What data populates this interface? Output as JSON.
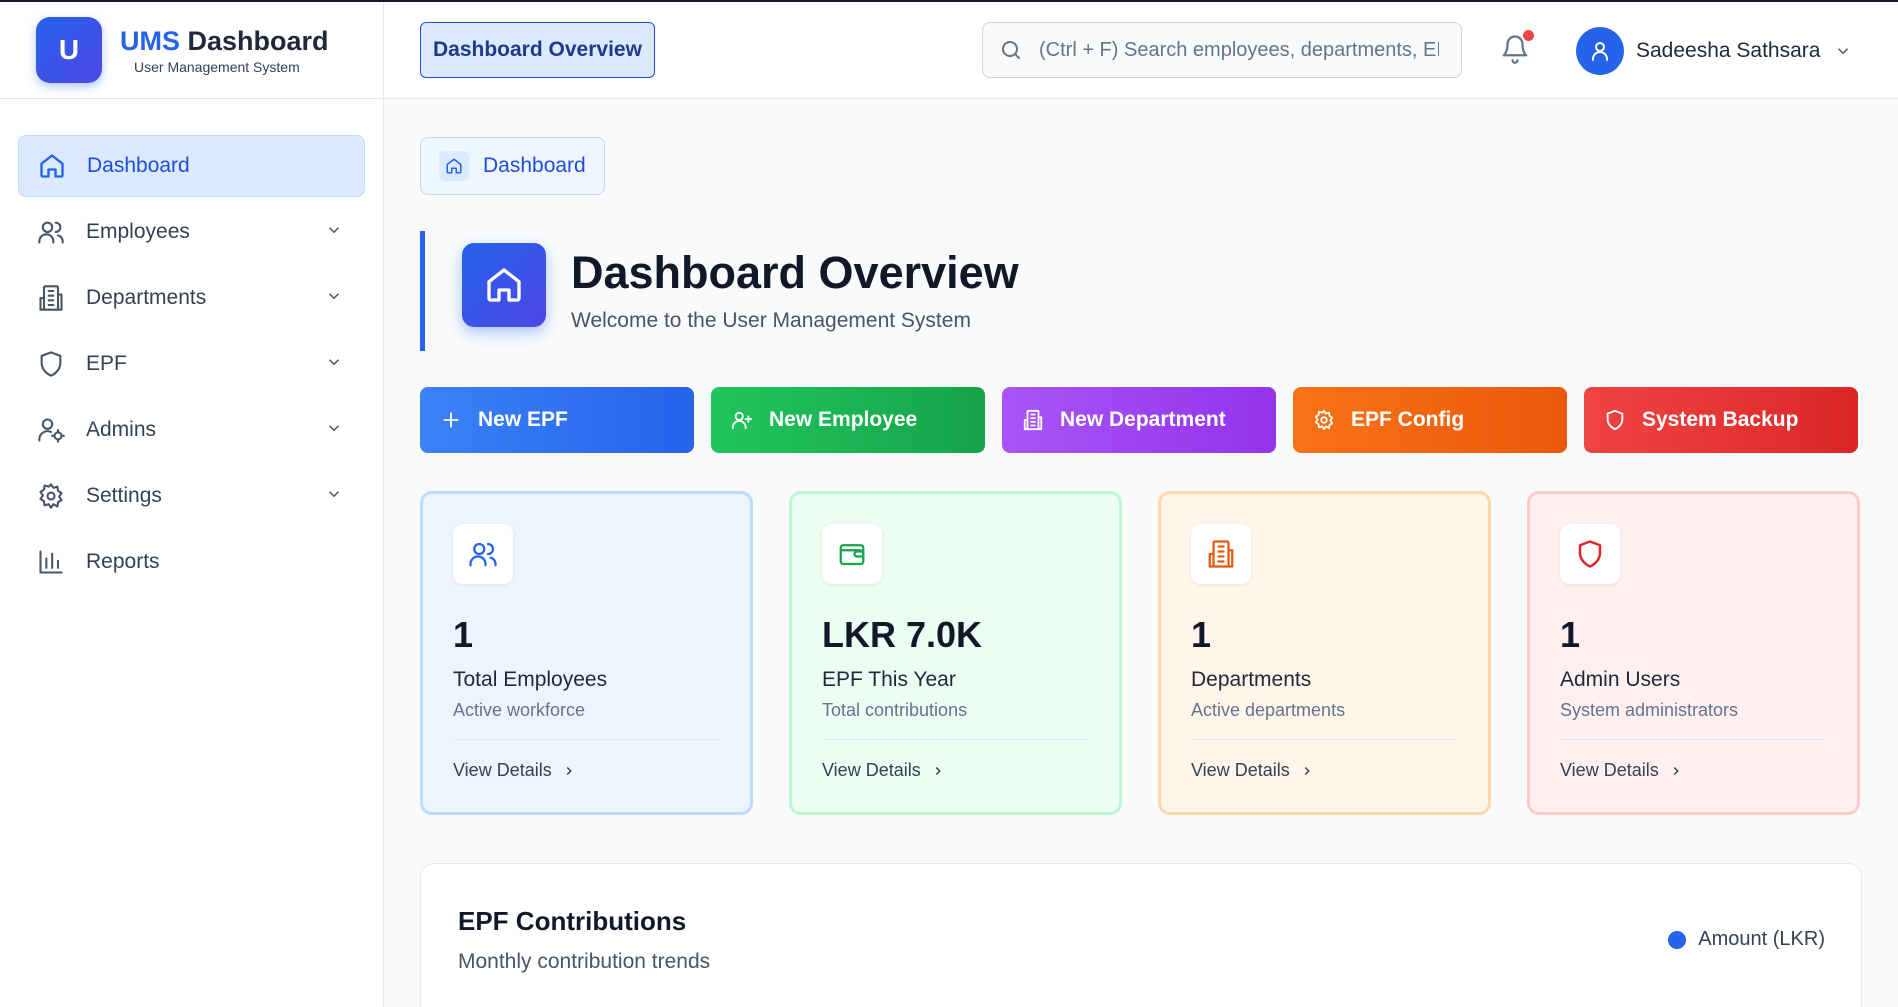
{
  "brand": {
    "logo_letter": "U",
    "title_part1": "UMS",
    "title_part2": "Dashboard",
    "subtitle": "User Management System"
  },
  "sidebar": {
    "items": [
      {
        "label": "Dashboard",
        "icon": "home-icon",
        "active": true
      },
      {
        "label": "Employees",
        "icon": "users-icon",
        "expandable": true
      },
      {
        "label": "Departments",
        "icon": "building-icon",
        "expandable": true
      },
      {
        "label": "EPF",
        "icon": "shield-icon",
        "expandable": true
      },
      {
        "label": "Admins",
        "icon": "user-cog-icon",
        "expandable": true
      },
      {
        "label": "Settings",
        "icon": "gear-icon",
        "expandable": true
      },
      {
        "label": "Reports",
        "icon": "bar-chart-icon"
      }
    ]
  },
  "header": {
    "title": "Dashboard Overview",
    "search_placeholder": "(Ctrl + F) Search employees, departments, EPF...",
    "notification_indicator": true,
    "user_name": "Sadeesha Sathsara"
  },
  "breadcrumb": {
    "label": "Dashboard"
  },
  "page": {
    "title": "Dashboard Overview",
    "subtitle": "Welcome to the User Management System"
  },
  "actions": [
    {
      "label": "New EPF",
      "icon": "plus-icon",
      "color": "#2563eb"
    },
    {
      "label": "New Employee",
      "icon": "user-plus-icon",
      "color": "#16a34a"
    },
    {
      "label": "New Department",
      "icon": "building-icon",
      "color": "#9333ea"
    },
    {
      "label": "EPF Config",
      "icon": "gear-icon",
      "color": "#ea580c"
    },
    {
      "label": "System Backup",
      "icon": "shield-icon",
      "color": "#dc2626"
    }
  ],
  "stats": [
    {
      "value": "1",
      "label": "Total Employees",
      "sub": "Active workforce",
      "link": "View Details",
      "icon": "users-icon",
      "color": "#2563eb"
    },
    {
      "value": "LKR 7.0K",
      "label": "EPF This Year",
      "sub": "Total contributions",
      "link": "View Details",
      "icon": "wallet-icon",
      "color": "#16a34a"
    },
    {
      "value": "1",
      "label": "Departments",
      "sub": "Active departments",
      "link": "View Details",
      "icon": "building-icon",
      "color": "#ea580c"
    },
    {
      "value": "1",
      "label": "Admin Users",
      "sub": "System administrators",
      "link": "View Details",
      "icon": "shield-icon",
      "color": "#dc2626"
    }
  ],
  "epf_chart": {
    "title": "EPF Contributions",
    "subtitle": "Monthly contribution trends",
    "legend": "Amount (LKR)",
    "legend_color": "#2563eb"
  }
}
